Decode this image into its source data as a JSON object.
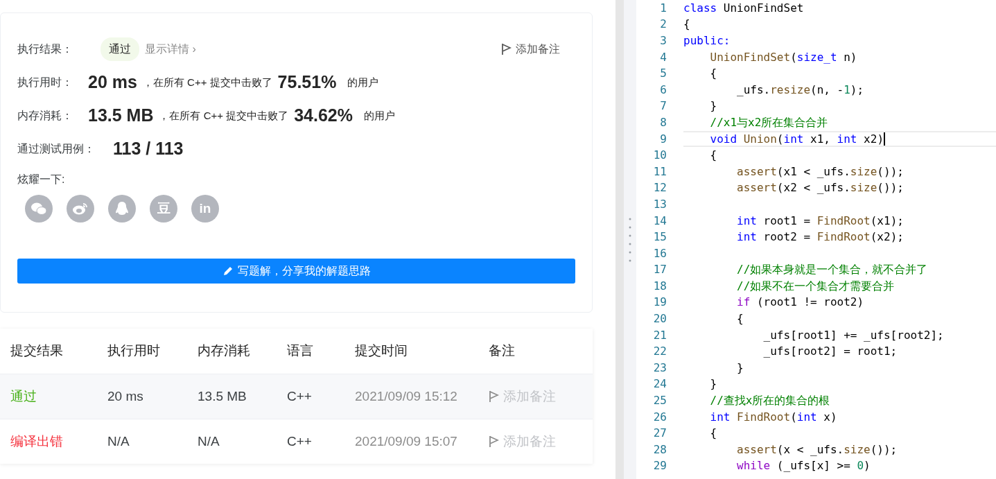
{
  "result": {
    "label": "执行结果：",
    "status": "通过",
    "details_link": "显示详情 ›",
    "note_button": "添加备注"
  },
  "stats": [
    {
      "label": "执行用时：",
      "value": "20 ms",
      "text": "，在所有 C++ 提交中击败了",
      "percent": "75.51%",
      "suffix": "的用户"
    },
    {
      "label": "内存消耗：",
      "value": "13.5 MB",
      "text": "，在所有 C++ 提交中击败了",
      "percent": "34.62%",
      "suffix": "的用户"
    }
  ],
  "test_cases": {
    "label": "通过测试用例：",
    "value": "113 / 113"
  },
  "share": {
    "label": "炫耀一下:",
    "buttons": [
      {
        "kind": "chat"
      },
      {
        "kind": "swirl"
      },
      {
        "kind": "penguin"
      },
      {
        "kind": "glyph",
        "text": "豆"
      },
      {
        "kind": "glyph",
        "text": "in"
      }
    ]
  },
  "write_button": "写题解，分享我的解题思路",
  "submissions": {
    "columns": [
      "提交结果",
      "执行用时",
      "内存消耗",
      "语言",
      "提交时间",
      "备注"
    ],
    "rows": [
      {
        "status": "通过",
        "kind": "accepted",
        "time": "20 ms",
        "memory": "13.5 MB",
        "language": "C++",
        "submitted": "2021/09/09 15:12",
        "note": "添加备注"
      },
      {
        "status": "编译出错",
        "kind": "error",
        "time": "N/A",
        "memory": "N/A",
        "language": "C++",
        "submitted": "2021/09/09 15:07",
        "note": "添加备注"
      }
    ]
  },
  "editor": {
    "lines": [
      {
        "num": "1",
        "current": false,
        "tokens": [
          {
            "kind": "kw",
            "text": "class"
          },
          {
            "kind": "plain",
            "text": " UnionFindSet"
          }
        ]
      },
      {
        "num": "2",
        "current": false,
        "tokens": [
          {
            "kind": "plain",
            "text": "{"
          }
        ]
      },
      {
        "num": "3",
        "current": false,
        "tokens": [
          {
            "kind": "kw",
            "text": "public:"
          }
        ]
      },
      {
        "num": "4",
        "current": false,
        "tokens": [
          {
            "kind": "fn",
            "text": "    UnionFindSet"
          },
          {
            "kind": "plain",
            "text": "("
          },
          {
            "kind": "kw",
            "text": "size_t"
          },
          {
            "kind": "plain",
            "text": " n)"
          }
        ]
      },
      {
        "num": "5",
        "current": false,
        "tokens": [
          {
            "kind": "plain",
            "text": "    {"
          }
        ]
      },
      {
        "num": "6",
        "current": false,
        "tokens": [
          {
            "kind": "plain",
            "text": "        _ufs."
          },
          {
            "kind": "fn",
            "text": "resize"
          },
          {
            "kind": "plain",
            "text": "(n, -"
          },
          {
            "kind": "num",
            "text": "1"
          },
          {
            "kind": "plain",
            "text": ");"
          }
        ]
      },
      {
        "num": "7",
        "current": false,
        "tokens": [
          {
            "kind": "plain",
            "text": "    }"
          }
        ]
      },
      {
        "num": "8",
        "current": false,
        "tokens": [
          {
            "kind": "comment",
            "text": "    //x1与x2所在集合合并"
          }
        ]
      },
      {
        "num": "9",
        "current": true,
        "tokens": [
          {
            "kind": "kw",
            "text": "    void"
          },
          {
            "kind": "fn",
            "text": " Union"
          },
          {
            "kind": "plain",
            "text": "("
          },
          {
            "kind": "kw",
            "text": "int"
          },
          {
            "kind": "plain",
            "text": " x1, "
          },
          {
            "kind": "kw",
            "text": "int"
          },
          {
            "kind": "plain",
            "text": " x2)"
          }
        ]
      },
      {
        "num": "10",
        "current": false,
        "tokens": [
          {
            "kind": "plain",
            "text": "    {"
          }
        ]
      },
      {
        "num": "11",
        "current": false,
        "tokens": [
          {
            "kind": "fn",
            "text": "        assert"
          },
          {
            "kind": "plain",
            "text": "(x1 < _ufs."
          },
          {
            "kind": "fn",
            "text": "size"
          },
          {
            "kind": "plain",
            "text": "());"
          }
        ]
      },
      {
        "num": "12",
        "current": false,
        "tokens": [
          {
            "kind": "fn",
            "text": "        assert"
          },
          {
            "kind": "plain",
            "text": "(x2 < _ufs."
          },
          {
            "kind": "fn",
            "text": "size"
          },
          {
            "kind": "plain",
            "text": "());"
          }
        ]
      },
      {
        "num": "13",
        "current": false
      },
      {
        "num": "14",
        "current": false,
        "tokens": [
          {
            "kind": "kw",
            "text": "        int"
          },
          {
            "kind": "plain",
            "text": " root1 = "
          },
          {
            "kind": "fn",
            "text": "FindRoot"
          },
          {
            "kind": "plain",
            "text": "(x1);"
          }
        ]
      },
      {
        "num": "15",
        "current": false,
        "tokens": [
          {
            "kind": "kw",
            "text": "        int"
          },
          {
            "kind": "plain",
            "text": " root2 = "
          },
          {
            "kind": "fn",
            "text": "FindRoot"
          },
          {
            "kind": "plain",
            "text": "(x2);"
          }
        ]
      },
      {
        "num": "16",
        "current": false
      },
      {
        "num": "17",
        "current": false,
        "tokens": [
          {
            "kind": "comment",
            "text": "        //如果本身就是一个集合，就不合并了"
          }
        ]
      },
      {
        "num": "18",
        "current": false,
        "tokens": [
          {
            "kind": "comment",
            "text": "        //如果不在一个集合才需要合并"
          }
        ]
      },
      {
        "num": "19",
        "current": false,
        "tokens": [
          {
            "kind": "ctl",
            "text": "        if"
          },
          {
            "kind": "plain",
            "text": " (root1 != root2)"
          }
        ]
      },
      {
        "num": "20",
        "current": false,
        "tokens": [
          {
            "kind": "plain",
            "text": "        {"
          }
        ]
      },
      {
        "num": "21",
        "current": false,
        "tokens": [
          {
            "kind": "plain",
            "text": "            _ufs[root1] += _ufs[root2];"
          }
        ]
      },
      {
        "num": "22",
        "current": false,
        "tokens": [
          {
            "kind": "plain",
            "text": "            _ufs[root2] = root1;"
          }
        ]
      },
      {
        "num": "23",
        "current": false,
        "tokens": [
          {
            "kind": "plain",
            "text": "        }"
          }
        ]
      },
      {
        "num": "24",
        "current": false,
        "tokens": [
          {
            "kind": "plain",
            "text": "    }"
          }
        ]
      },
      {
        "num": "25",
        "current": false,
        "tokens": [
          {
            "kind": "comment",
            "text": "    //查找x所在的集合的根"
          }
        ]
      },
      {
        "num": "26",
        "current": false,
        "tokens": [
          {
            "kind": "kw",
            "text": "    int"
          },
          {
            "kind": "fn",
            "text": " FindRoot"
          },
          {
            "kind": "plain",
            "text": "("
          },
          {
            "kind": "kw",
            "text": "int"
          },
          {
            "kind": "plain",
            "text": " x)"
          }
        ]
      },
      {
        "num": "27",
        "current": false,
        "tokens": [
          {
            "kind": "plain",
            "text": "    {"
          }
        ]
      },
      {
        "num": "28",
        "current": false,
        "tokens": [
          {
            "kind": "fn",
            "text": "        assert"
          },
          {
            "kind": "plain",
            "text": "(x < _ufs."
          },
          {
            "kind": "fn",
            "text": "size"
          },
          {
            "kind": "plain",
            "text": "());"
          }
        ]
      },
      {
        "num": "29",
        "current": false,
        "tokens": [
          {
            "kind": "ctl",
            "text": "        while"
          },
          {
            "kind": "plain",
            "text": " (_ufs[x] >= "
          },
          {
            "kind": "num",
            "text": "0"
          },
          {
            "kind": "plain",
            "text": ")"
          }
        ]
      }
    ]
  }
}
